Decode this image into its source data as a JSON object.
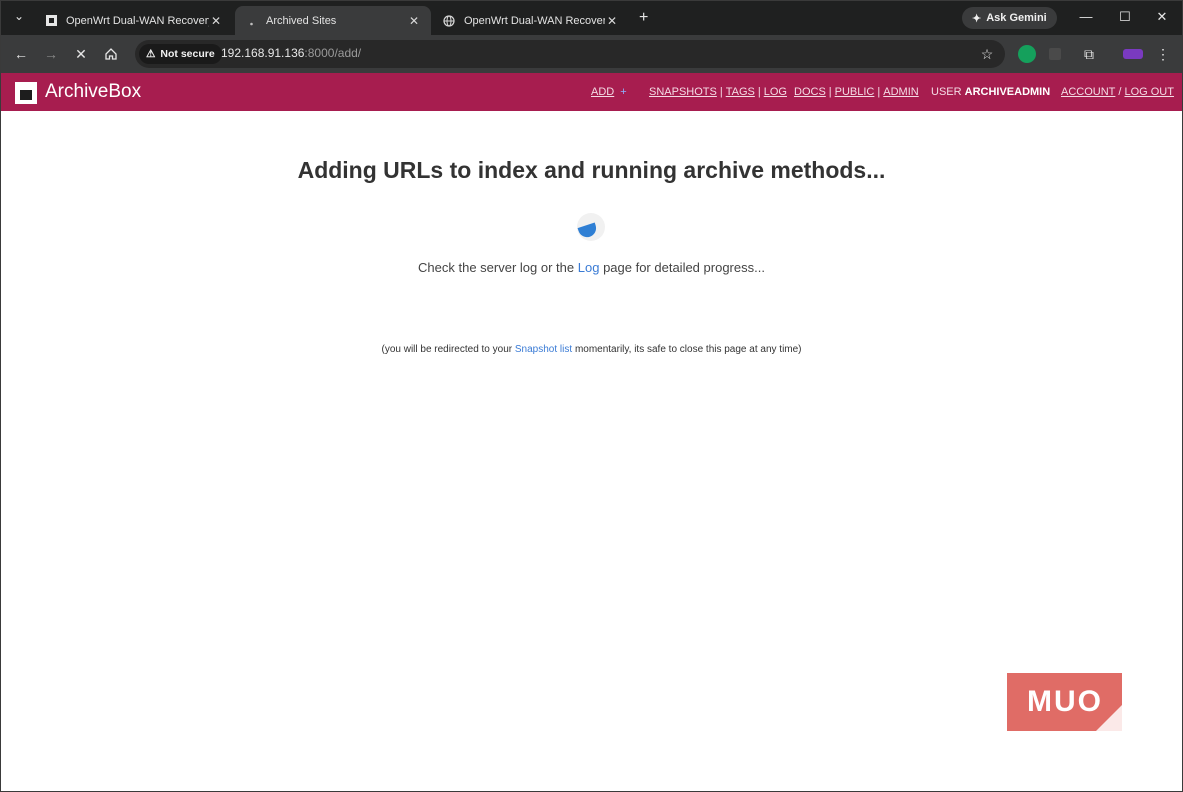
{
  "browser": {
    "tabs": [
      {
        "title": "OpenWrt Dual-WAN Recovery",
        "favicon": "document-icon",
        "active": false
      },
      {
        "title": "Archived Sites",
        "favicon": "loading-icon",
        "active": true
      },
      {
        "title": "OpenWrt Dual-WAN Recovery",
        "favicon": "globe-icon",
        "active": false
      }
    ],
    "gemini_label": "Ask Gemini",
    "security_label": "Not secure",
    "url_host": "192.168.91.136",
    "url_rest": ":8000/add/"
  },
  "header": {
    "brand": "ArchiveBox",
    "nav": {
      "add": "ADD",
      "snapshots": "SNAPSHOTS",
      "tags": "TAGS",
      "log": "LOG",
      "docs": "DOCS",
      "public": "PUBLIC",
      "admin": "ADMIN",
      "user_prefix": "USER",
      "username": "ARCHIVEADMIN",
      "account": "ACCOUNT",
      "logout": "LOG OUT"
    },
    "color": "#a71d4f"
  },
  "main": {
    "headline": "Adding URLs to index and running archive methods...",
    "progress_before": "Check the server log or the",
    "progress_link": "Log",
    "progress_after": "page for detailed progress...",
    "redirect_before": "(you will be redirected to your",
    "redirect_link": "Snapshot list",
    "redirect_after": "momentarily, its safe to close this page at any time)"
  },
  "watermark": {
    "text": "MUO"
  }
}
